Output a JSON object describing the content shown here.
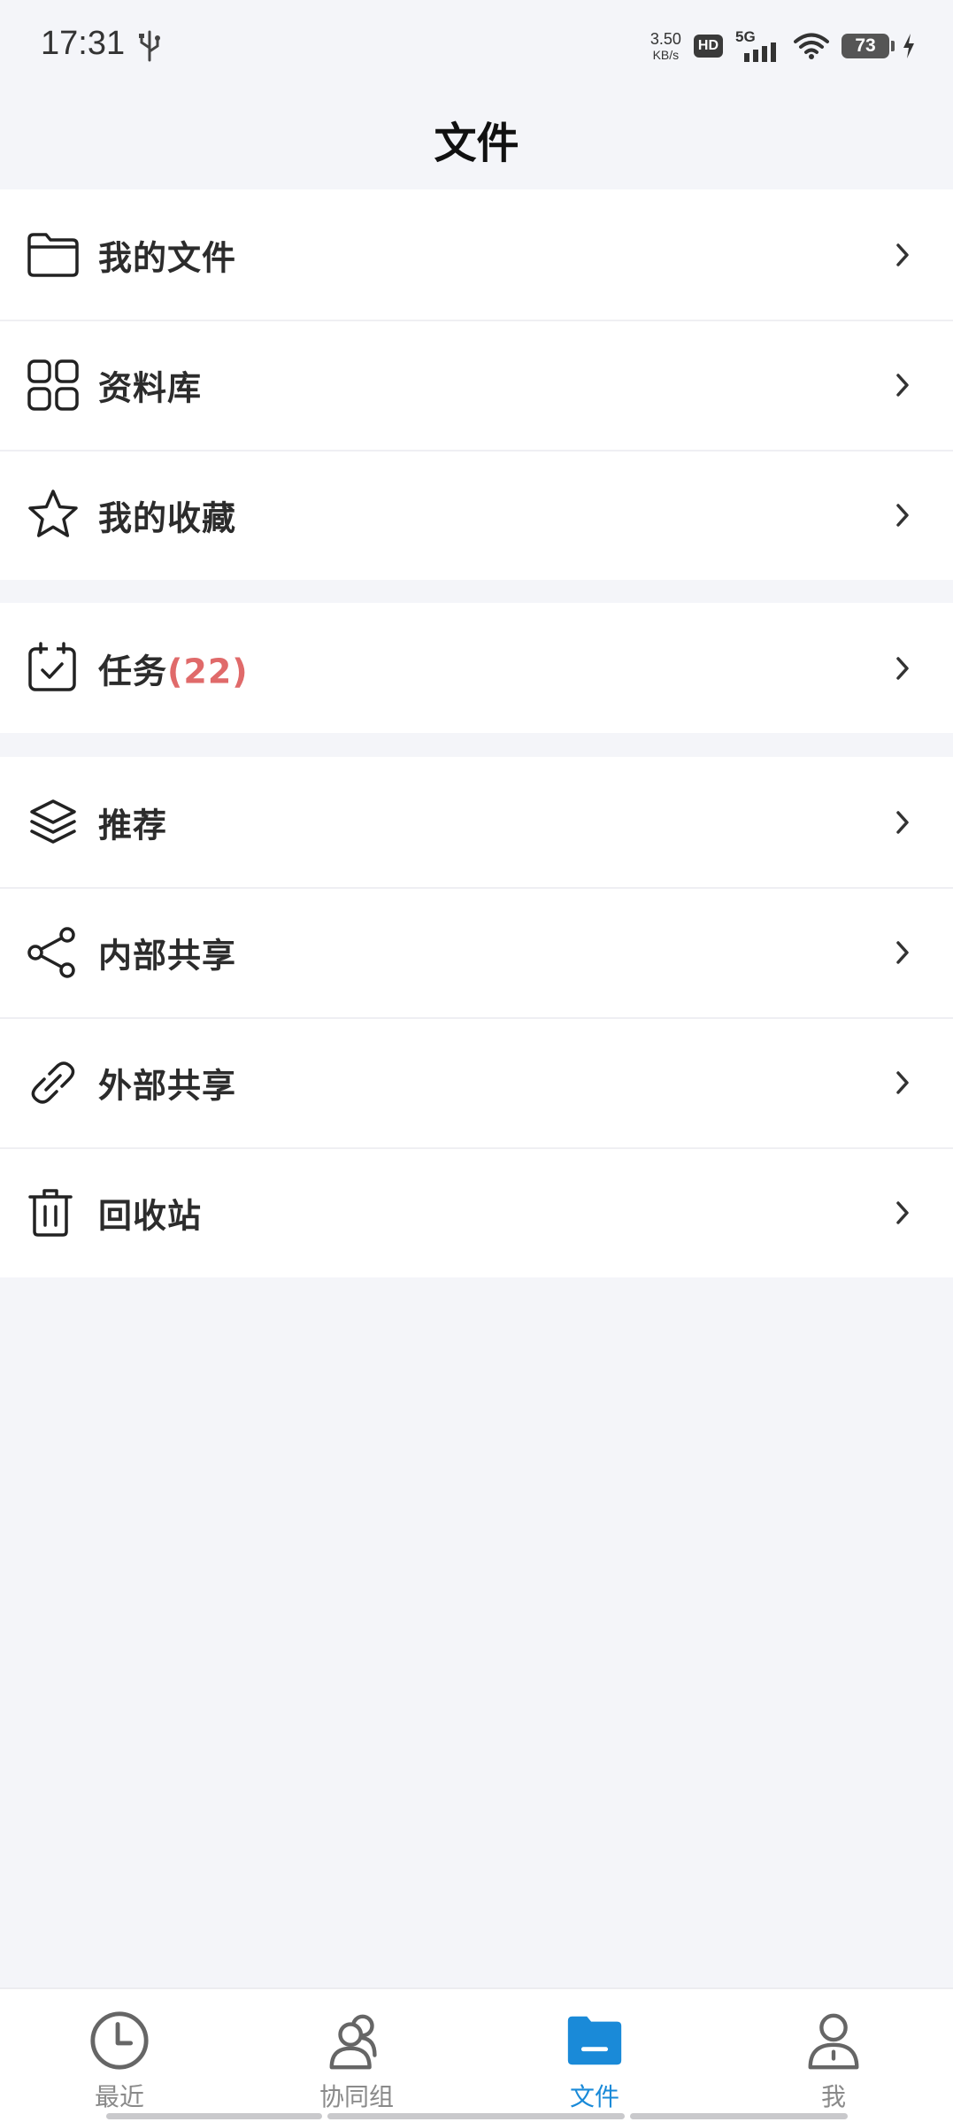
{
  "status_bar": {
    "time": "17:31",
    "net_speed_value": "3.50",
    "net_speed_unit": "KB/s",
    "hd_badge": "HD",
    "network_type": "5G",
    "battery_level": "73",
    "icons": [
      "usb-icon",
      "signal-icon",
      "wifi-icon",
      "battery-icon",
      "charging-icon"
    ]
  },
  "header": {
    "title": "文件"
  },
  "groups": [
    {
      "items": [
        {
          "label": "我的文件",
          "icon": "folder-icon"
        },
        {
          "label": "资料库",
          "icon": "grid-icon"
        },
        {
          "label": "我的收藏",
          "icon": "star-icon"
        }
      ]
    },
    {
      "items": [
        {
          "label": "任务",
          "count": "(22)",
          "icon": "task-calendar-icon"
        }
      ]
    },
    {
      "items": [
        {
          "label": "推荐",
          "icon": "layers-icon"
        },
        {
          "label": "内部共享",
          "icon": "share-icon"
        },
        {
          "label": "外部共享",
          "icon": "link-icon"
        },
        {
          "label": "回收站",
          "icon": "trash-icon"
        }
      ]
    }
  ],
  "bottom_nav": {
    "active_index": 2,
    "items": [
      {
        "label": "最近",
        "icon": "clock-icon"
      },
      {
        "label": "协同组",
        "icon": "users-icon"
      },
      {
        "label": "文件",
        "icon": "folder-filled-icon"
      },
      {
        "label": "我",
        "icon": "user-icon"
      }
    ]
  },
  "colors": {
    "accent": "#1a8ad8",
    "badge_count": "#e06a6a",
    "background": "#f4f5f9",
    "text_primary": "#2c2c2c",
    "nav_inactive": "#8a8a8a"
  }
}
